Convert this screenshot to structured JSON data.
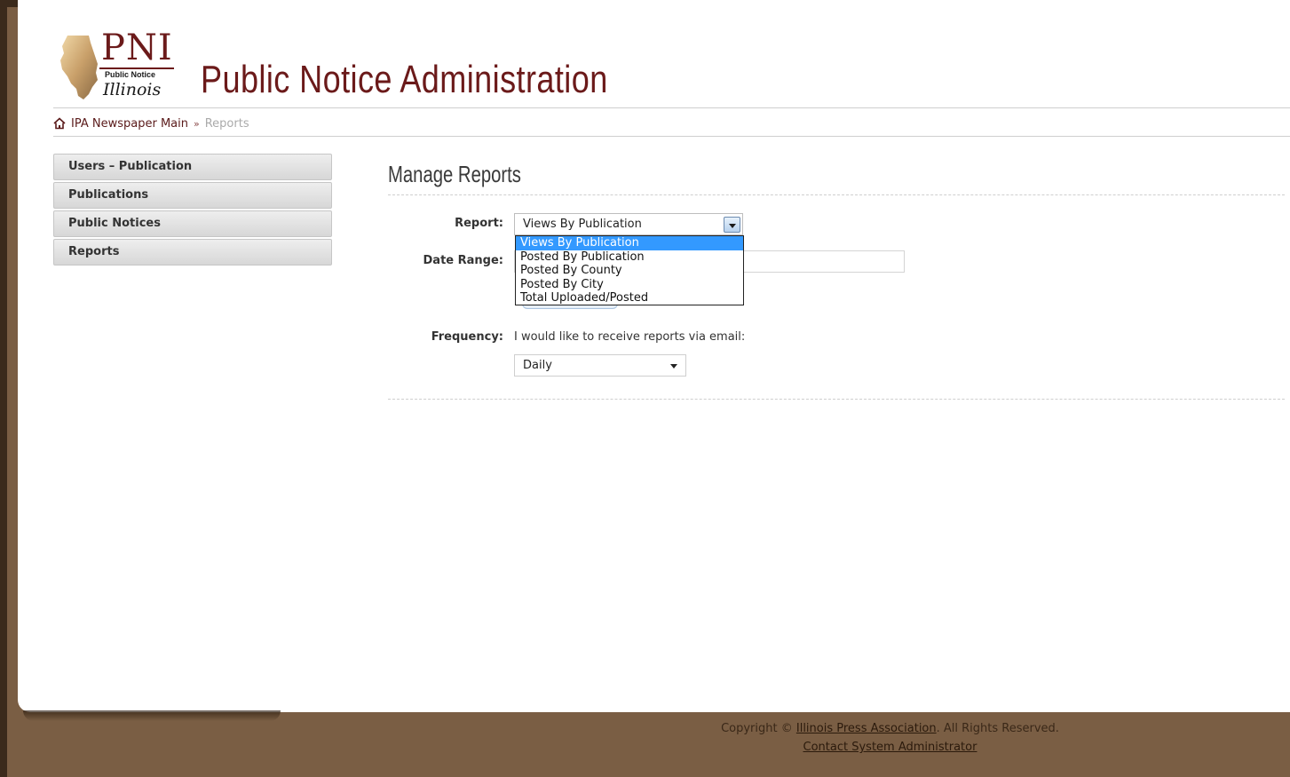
{
  "header": {
    "logo": {
      "abbr": "PNI",
      "line1": "Public Notice",
      "line2": "Illinois"
    },
    "title": "Public Notice Administration"
  },
  "breadcrumb": {
    "home_label": "IPA Newspaper Main",
    "separator": "»",
    "current": "Reports"
  },
  "sidebar": {
    "items": [
      {
        "label": "Users – Publication"
      },
      {
        "label": "Publications"
      },
      {
        "label": "Public Notices"
      },
      {
        "label": "Reports"
      }
    ]
  },
  "main": {
    "title": "Manage Reports",
    "report": {
      "label": "Report:",
      "selected": "Views By Publication",
      "options": [
        "Views By Publication",
        "Posted By Publication",
        "Posted By County",
        "Posted By City",
        "Total Uploaded/Posted"
      ]
    },
    "date_range": {
      "label": "Date Range:",
      "value": ""
    },
    "frequency": {
      "label": "Frequency:",
      "text": "I would like to receive reports via email:",
      "selected": "Daily"
    }
  },
  "footer": {
    "copyright_prefix": "Copyright ©",
    "copyright_link": "Illinois Press Association",
    "copyright_suffix": ". All Rights Reserved.",
    "contact_link": "Contact System Administrator"
  },
  "colors": {
    "brand": "#6b1a1a",
    "footer_bg": "#7a5e44",
    "dropdown_highlight": "#3399ff"
  }
}
